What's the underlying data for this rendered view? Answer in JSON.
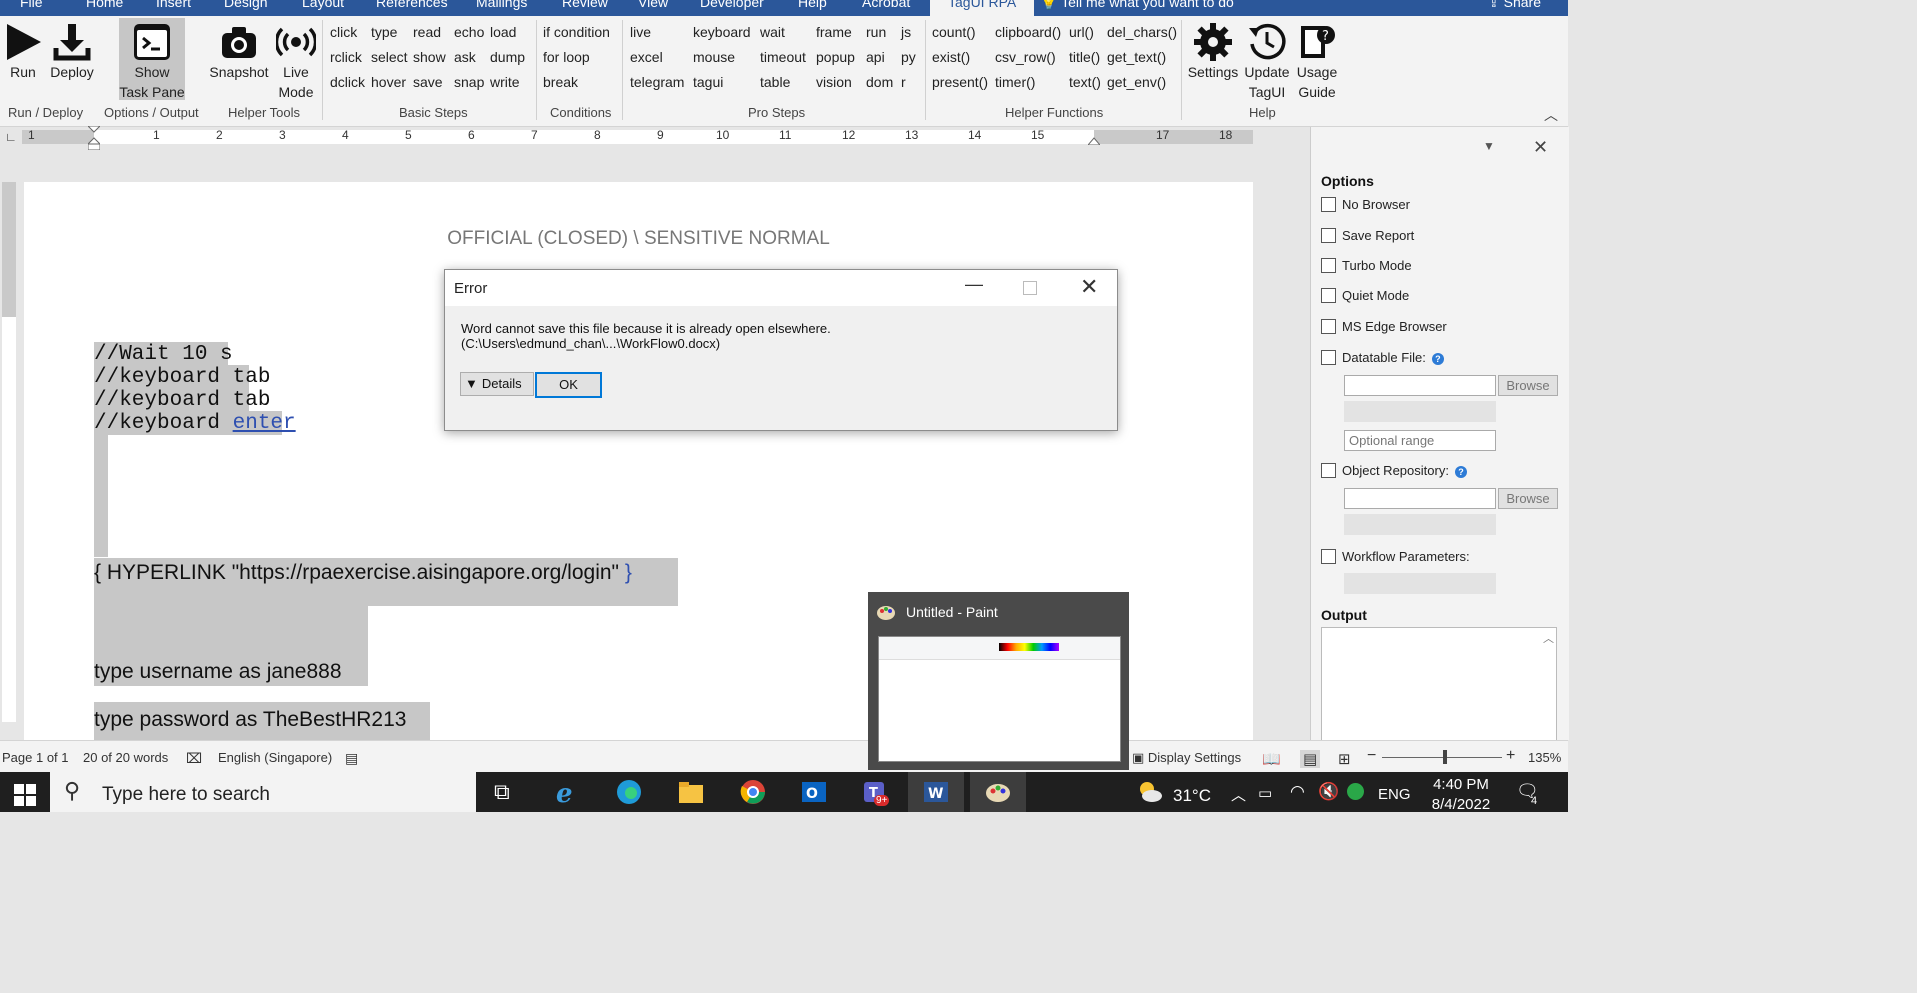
{
  "ribbon_tabs": [
    "File",
    "Home",
    "Insert",
    "Design",
    "Layout",
    "References",
    "Mailings",
    "Review",
    "View",
    "Developer",
    "Help",
    "Acrobat",
    "TagUI RPA",
    "Tell me what you want to do",
    "Share"
  ],
  "ribbon": {
    "run": "Run",
    "deploy": "Deploy",
    "show_task_pane": "Show Task Pane",
    "snapshot": "Snapshot",
    "live_mode": "Live Mode",
    "basic_steps": [
      "click",
      "type",
      "read",
      "echo",
      "load",
      "rclick",
      "select",
      "show",
      "ask",
      "dump",
      "dclick",
      "hover",
      "save",
      "snap",
      "write"
    ],
    "conditions": [
      "if condition",
      "for loop",
      "break"
    ],
    "pro_steps": [
      "live",
      "keyboard",
      "wait",
      "frame",
      "run",
      "js",
      "excel",
      "mouse",
      "timeout",
      "popup",
      "api",
      "py",
      "telegram",
      "tagui",
      "table",
      "vision",
      "dom",
      "r"
    ],
    "helper_functions": [
      "count()",
      "clipboard()",
      "url()",
      "del_chars()",
      "exist()",
      "csv_row()",
      "title()",
      "get_text()",
      "present()",
      "timer()",
      "text()",
      "get_env()"
    ],
    "settings": "Settings",
    "update_tagui": "Update TagUI",
    "usage_guide": "Usage Guide",
    "groups": [
      "Run / Deploy",
      "Options / Output",
      "Helper Tools",
      "Basic Steps",
      "Conditions",
      "Pro Steps",
      "Helper Functions",
      "Help"
    ]
  },
  "ruler_numbers": [
    "1",
    "1",
    "2",
    "3",
    "4",
    "5",
    "6",
    "7",
    "8",
    "9",
    "10",
    "11",
    "12",
    "13",
    "14",
    "15",
    "17",
    "18"
  ],
  "document": {
    "header": "OFFICIAL (CLOSED) \\ SENSITIVE NORMAL",
    "code_lines": [
      "//Wait 10 s",
      "//keyboard tab",
      "//keyboard tab",
      "//keyboard "
    ],
    "code_link": "enter",
    "hyperlink_field": "{ HYPERLINK \"https://rpaexercise.aisingapore.org/login\" ",
    "hyperlink_brace": "}",
    "line_username": "type username as jane888",
    "line_password": "type password as TheBestHR213"
  },
  "dialog": {
    "title": "Error",
    "message_1": "Word cannot save this file because it is already open elsewhere.",
    "message_2": "(C:\\Users\\edmund_chan\\...\\WorkFlow0.docx)",
    "details": "Details",
    "ok": "OK"
  },
  "task_pane": {
    "options_heading": "Options",
    "no_browser": "No Browser",
    "save_report": "Save Report",
    "turbo_mode": "Turbo Mode",
    "quiet_mode": "Quiet Mode",
    "ms_edge_browser": "MS Edge Browser",
    "datatable_file": "Datatable File:",
    "browse": "Browse",
    "optional_range": "Optional range",
    "object_repository": "Object Repository:",
    "workflow_parameters": "Workflow Parameters:",
    "output_heading": "Output"
  },
  "paint_preview": {
    "title": "Untitled - Paint"
  },
  "status_bar": {
    "page": "Page 1 of 1",
    "words": "20 of 20 words",
    "language": "English (Singapore)",
    "display_settings": "Display Settings",
    "zoom_out": "−",
    "zoom_in": "+",
    "zoom": "135%"
  },
  "taskbar": {
    "search_placeholder": "Type here to search",
    "teams_badge": "9+",
    "temperature": "31°C",
    "language": "ENG",
    "time": "4:40 PM",
    "date": "8/4/2022",
    "notifications": "4"
  },
  "colors": {
    "word_blue": "#2b579a",
    "selection_grey": "#c7c7c7",
    "link_blue": "#2e4fb0"
  }
}
